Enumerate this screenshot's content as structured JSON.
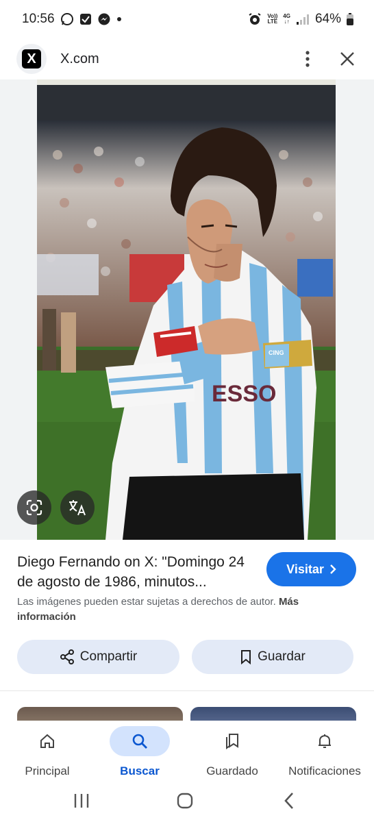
{
  "status_bar": {
    "time": "10:56",
    "net_top": "Vo))",
    "net_bottom": "LTE",
    "gen": "4G",
    "battery": "64%"
  },
  "header": {
    "site_logo_letter": "X",
    "site": "X.com"
  },
  "result": {
    "title": "Diego Fernando on X: \"Domingo 24 de agosto de 1986, minutos...",
    "visit_label": "Visitar",
    "copyright_text": "Las imágenes pueden estar sujetas a derechos de autor.",
    "copyright_link": "Más información",
    "share_label": "Compartir",
    "save_label": "Guardar"
  },
  "photo": {
    "armband_text": "CING",
    "jersey_text": "ESSO"
  },
  "bottom_nav": [
    {
      "label": "Principal",
      "icon": "home-icon"
    },
    {
      "label": "Buscar",
      "icon": "search-icon",
      "active": true
    },
    {
      "label": "Guardado",
      "icon": "collections-icon"
    },
    {
      "label": "Notificaciones",
      "icon": "bell-icon"
    }
  ],
  "colors": {
    "accent": "#1a73e8",
    "active_nav_bg": "#d3e3fd",
    "pill_bg": "#e3eaf7"
  }
}
